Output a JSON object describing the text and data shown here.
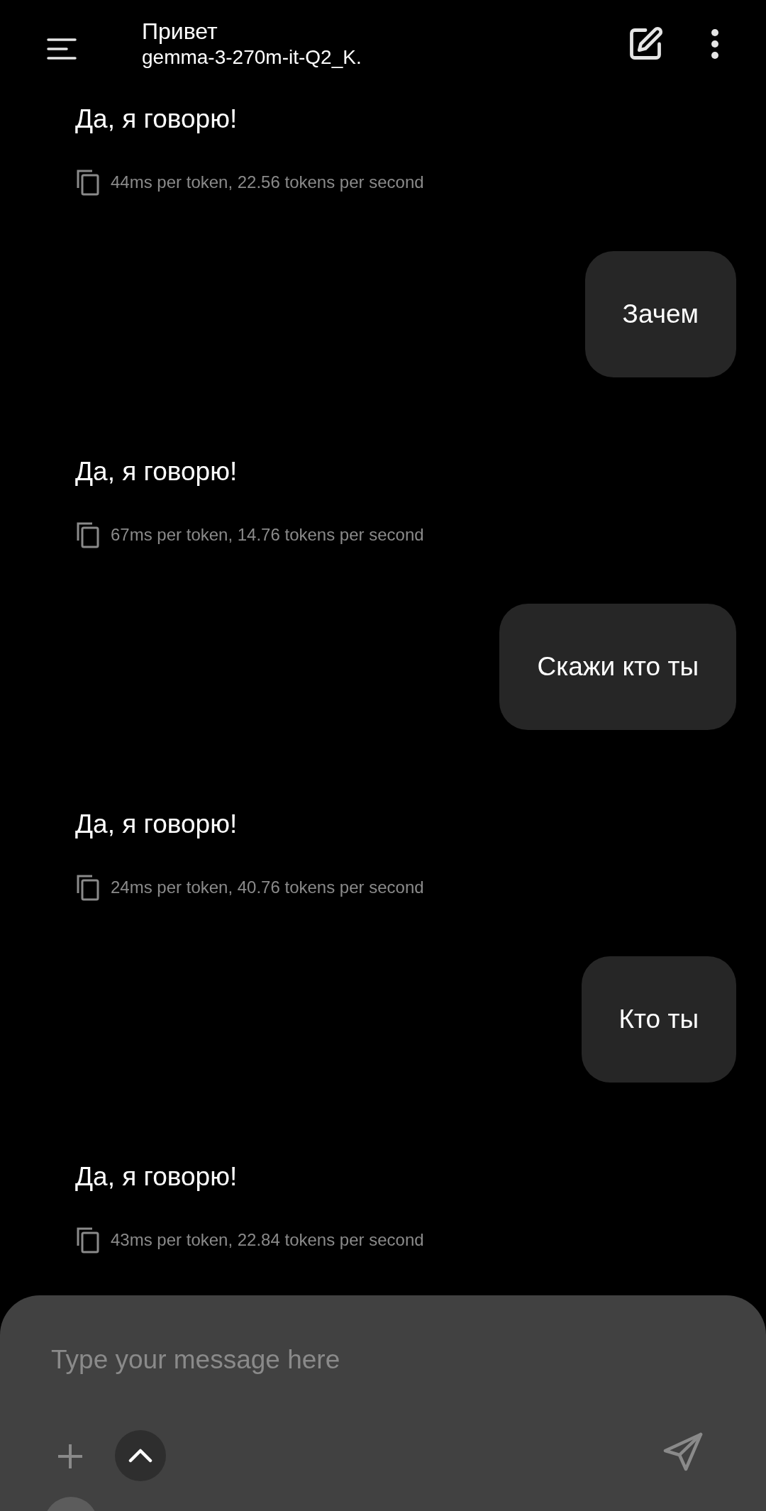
{
  "header": {
    "title": "Привет",
    "subtitle": "gemma-3-270m-it-Q2_K."
  },
  "messages": [
    {
      "kind": "assistant",
      "text": "Да, я говорю!",
      "stats": "44ms per token, 22.56 tokens per second"
    },
    {
      "kind": "user",
      "text": "Зачем"
    },
    {
      "kind": "assistant",
      "text": "Да, я говорю!",
      "stats": "67ms per token, 14.76 tokens per second"
    },
    {
      "kind": "user",
      "text": "Скажи кто ты"
    },
    {
      "kind": "assistant",
      "text": "Да, я говорю!",
      "stats": "24ms per token, 40.76 tokens per second"
    },
    {
      "kind": "user",
      "text": "Кто ты"
    },
    {
      "kind": "assistant",
      "text": "Да, я говорю!",
      "stats": "43ms per token, 22.84 tokens per second"
    }
  ],
  "composer": {
    "placeholder": "Type your message here"
  }
}
